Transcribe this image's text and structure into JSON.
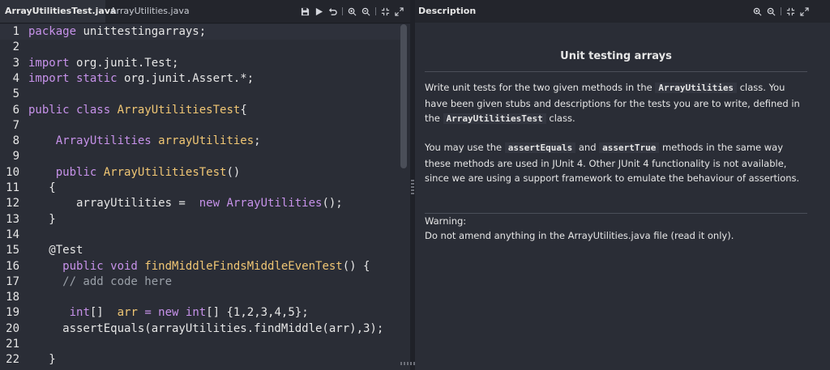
{
  "editor": {
    "tabs": [
      "ArrayUtilitiesTest.java",
      "ArrayUtilities.java"
    ],
    "toolbar_icons": [
      "save-icon",
      "run-icon",
      "undo-icon",
      "zoom-in-icon",
      "zoom-out-icon",
      "collapse-icon",
      "expand-icon"
    ],
    "lines": [
      {
        "n": "1",
        "tokens": [
          [
            "kw",
            "package"
          ],
          [
            "",
            "unittestingarrays;"
          ]
        ]
      },
      {
        "n": "2",
        "tokens": []
      },
      {
        "n": "3",
        "tokens": [
          [
            "kw",
            "import"
          ],
          [
            "",
            "org.junit.Test;"
          ]
        ]
      },
      {
        "n": "4",
        "tokens": [
          [
            "kw",
            "import static"
          ],
          [
            "",
            "org.junit.Assert.*;"
          ]
        ]
      },
      {
        "n": "5",
        "tokens": []
      },
      {
        "n": "6",
        "tokens": [
          [
            "kw",
            "public class"
          ],
          [
            "cls",
            "ArrayUtilitiesTest"
          ],
          [
            "",
            "{"
          ]
        ]
      },
      {
        "n": "7",
        "tokens": []
      },
      {
        "n": "8",
        "tokens": [
          [
            "",
            "   "
          ],
          [
            "typ",
            "ArrayUtilities"
          ],
          [
            "cls",
            "arrayUtilities"
          ],
          [
            "",
            ";"
          ]
        ]
      },
      {
        "n": "9",
        "tokens": []
      },
      {
        "n": "10",
        "tokens": [
          [
            "",
            "   "
          ],
          [
            "kw",
            "public"
          ],
          [
            "cls",
            "ArrayUtilitiesTest"
          ],
          [
            "",
            "()"
          ]
        ]
      },
      {
        "n": "11",
        "tokens": [
          [
            "",
            "   {"
          ]
        ]
      },
      {
        "n": "12",
        "tokens": [
          [
            "",
            "       arrayUtilities = "
          ],
          [
            "kw",
            "new"
          ],
          [
            "typ",
            "ArrayUtilities"
          ],
          [
            "",
            "();"
          ]
        ]
      },
      {
        "n": "13",
        "tokens": [
          [
            "",
            "   }"
          ]
        ]
      },
      {
        "n": "14",
        "tokens": []
      },
      {
        "n": "15",
        "tokens": [
          [
            "",
            "   @Test"
          ]
        ]
      },
      {
        "n": "16",
        "tokens": [
          [
            "",
            "    "
          ],
          [
            "kw",
            "public void"
          ],
          [
            "cls",
            "findMiddleFindsMiddleEvenTest"
          ],
          [
            "",
            "() {"
          ]
        ]
      },
      {
        "n": "17",
        "tokens": [
          [
            "",
            "    "
          ],
          [
            "cmt",
            "// add code here"
          ]
        ]
      },
      {
        "n": "18",
        "tokens": []
      },
      {
        "n": "19",
        "tokens": [
          [
            "",
            "     "
          ],
          [
            "kw",
            "int"
          ],
          [
            "",
            "[] "
          ],
          [
            "cls",
            "arr"
          ],
          [
            "",
            ""
          ],
          [
            "kw",
            "= new int"
          ],
          [
            "",
            "[] {1,2,3,4,5};"
          ]
        ]
      },
      {
        "n": "20",
        "tokens": [
          [
            "",
            "     assertEquals(arrayUtilities.findMiddle(arr),3);"
          ]
        ]
      },
      {
        "n": "21",
        "tokens": []
      },
      {
        "n": "22",
        "tokens": [
          [
            "",
            "   }"
          ]
        ]
      }
    ]
  },
  "description": {
    "header": "Description",
    "toolbar_icons": [
      "zoom-in-icon",
      "zoom-out-icon",
      "collapse-icon",
      "expand-icon"
    ],
    "title": "Unit testing arrays",
    "para1": [
      [
        "text",
        "Write unit tests for the two given methods in the "
      ],
      [
        "code",
        "ArrayUtilities"
      ],
      [
        "text",
        " class. You have been given stubs and descriptions for the tests you are to write, defined in the "
      ],
      [
        "code",
        "ArrayUtilitiesTest"
      ],
      [
        "text",
        " class."
      ]
    ],
    "para2": [
      [
        "text",
        "You may use the "
      ],
      [
        "code",
        "assertEquals"
      ],
      [
        "text",
        " and "
      ],
      [
        "code",
        "assertTrue"
      ],
      [
        "text",
        " methods in the same way these methods are used in JUnit 4. Other JUnit 4 functionality is not available, since we are using a support framework to emulate the behaviour of assertions."
      ]
    ],
    "warning_label": "Warning:",
    "warning_text": "Do not amend anything in the ArrayUtilities.java file (read it only)."
  }
}
